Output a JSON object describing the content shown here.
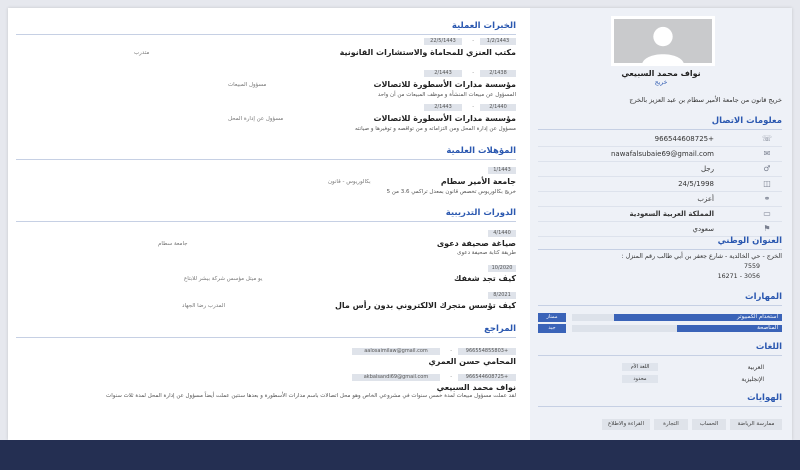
{
  "profile": {
    "name": "نواف محمد السبيعي",
    "role": "خريج",
    "summary": "خريج قانون من جامعة الأمير سطام بن عبد العزيز بالخرج"
  },
  "contact": {
    "title": "معلومات الاتصال",
    "rows": [
      {
        "icon": "phone-icon",
        "glyph": "☏",
        "value": "+966544608725"
      },
      {
        "icon": "email-icon",
        "glyph": "✉",
        "value": "nawafalsubaie69@gmail.com"
      },
      {
        "icon": "gender-icon",
        "glyph": "♂",
        "value": "رجل"
      },
      {
        "icon": "birthday-icon",
        "glyph": "◫",
        "value": "24/5/1998"
      },
      {
        "icon": "marital-status-icon",
        "glyph": "⚭",
        "value": "أعزب"
      },
      {
        "icon": "country-icon",
        "glyph": "▭",
        "value": "المملكة العربية السعودية"
      },
      {
        "icon": "nationality-icon",
        "glyph": "⚑",
        "value": "سعودي"
      }
    ]
  },
  "address": {
    "title": "العنوان الوطني",
    "line1": "الخرج - حي الخالدية - شارع جعفر بن أبي طالب رقم المنزل :",
    "line2": "7559",
    "line3": "3056 - 16271"
  },
  "skills": {
    "title": "المهارات",
    "items": [
      {
        "name": "استخدام الكمبيوتر",
        "level": "ممتاز",
        "percent": 80
      },
      {
        "name": "المناصحة",
        "level": "جيد",
        "percent": 50
      }
    ]
  },
  "languages": {
    "title": "اللغات",
    "items": [
      {
        "name": "العربية",
        "level": "اللغة الأم"
      },
      {
        "name": "الإنجليزية",
        "level": "محدود"
      }
    ]
  },
  "hobbies": {
    "title": "الهوايات",
    "items": [
      "ممارسة الرياضة",
      "الحساب",
      "التجارة",
      "القراءة والاطلاع"
    ]
  },
  "experience": {
    "title": "الخبرات العملية",
    "items": [
      {
        "from": "1/2/1443",
        "to": "22/5/1443",
        "org": "مكتب العنزي للمحاماة والاستشارات القانونية",
        "position": "متدرب",
        "desc": ""
      },
      {
        "from": "2/1438",
        "to": "2/1443",
        "org": "مؤسسة مدارات الأسطورة للاتصالات",
        "position": "مسؤول المبيعات",
        "desc": "المسؤول عن مبيعات المنشأة و موظف المبيعات من أن واحد"
      },
      {
        "from": "2/1440",
        "to": "2/1443",
        "org": "مؤسسة مدارات الأسطورة للاتصالات",
        "position": "مسؤول عن إدارة المحل",
        "desc": "مسؤول عن إدارة المحل ومن التزاماته و من تواقصه و توفيرها و صيانته"
      }
    ]
  },
  "education": {
    "title": "المؤهلات العلمية",
    "items": [
      {
        "date": "1/1443",
        "school": "جامعة الأمير سطام",
        "degree": "بكالوريوس - قانون",
        "desc": "خريج بكالوريوس تخصص قانون بمعدل تراكمي 3.6 من 5"
      }
    ]
  },
  "courses": {
    "title": "الدورات التدريبية",
    "items": [
      {
        "date": "4/1440",
        "name": "صياغة صحيفة دعوى",
        "provider": "جامعة سطام",
        "desc": "طريقة كتابة صحيفة دعوى"
      },
      {
        "date": "10/2020",
        "name": "كيف تجد شغفك",
        "provider": "يو ميتل مؤسس شركة بيشر للابتاع",
        "desc": ""
      },
      {
        "date": "8/2021",
        "name": "كيف تؤسس متجرك الالكتروني بدون رأس مال",
        "provider": "المدرب رضا الجهاد",
        "desc": ""
      }
    ]
  },
  "references": {
    "title": "المراجع",
    "items": [
      {
        "name": "المحامي حسن العمري",
        "phone": "+966554855803",
        "email": "aalosaimilaw@gmail.com"
      },
      {
        "name": "نواف محمد السبيعي",
        "phone": "+966544608725",
        "email": "akbalsandi69@gmail.com"
      }
    ],
    "note": "لقد عملت مسؤول مبيعات لمدة خمس سنوات في مشروعي الخاص وهو محل اتصالات باسم مدارات الأسطورة و بعدها سنتين عملت أيضاً مسؤول عن إدارة المحل لمدة ثلاث سنوات"
  }
}
